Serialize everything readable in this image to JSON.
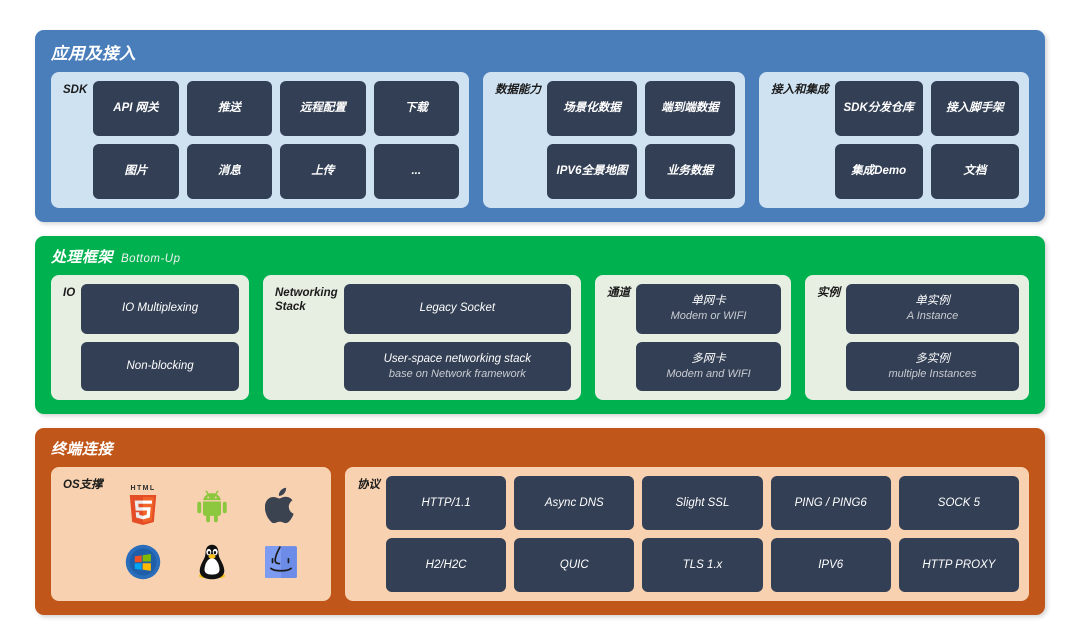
{
  "diagram": {
    "title_visible": false
  },
  "layers": [
    {
      "id": "application-access",
      "title": "应用及接入",
      "subtitle": "",
      "color": "#4a7ebb",
      "panel_color": "#cfe2f2",
      "panels": [
        {
          "id": "sdk",
          "label": "SDK",
          "columns": 4,
          "items": [
            {
              "text": "API 网关"
            },
            {
              "text": "推送"
            },
            {
              "text": "远程配置"
            },
            {
              "text": "下载"
            },
            {
              "text": "图片"
            },
            {
              "text": "消息"
            },
            {
              "text": "上传"
            },
            {
              "text": "..."
            }
          ]
        },
        {
          "id": "data-capability",
          "label": "数据能力",
          "columns": 2,
          "items": [
            {
              "text": "场景化数据"
            },
            {
              "text": "端到端数据"
            },
            {
              "text": "IPV6全景地图"
            },
            {
              "text": "业务数据"
            }
          ]
        },
        {
          "id": "access-integration",
          "label": "接入和集成",
          "columns": 2,
          "items": [
            {
              "text": "SDK分发仓库"
            },
            {
              "text": "接入脚手架"
            },
            {
              "text": "集成Demo"
            },
            {
              "text": "文档"
            }
          ]
        }
      ]
    },
    {
      "id": "processing-framework",
      "title": "处理框架",
      "subtitle": "Bottom-Up",
      "color": "#00b14f",
      "panel_color": "#e7efe3",
      "panels": [
        {
          "id": "io",
          "label": "IO",
          "columns": 1,
          "items": [
            {
              "text": "IO Multiplexing"
            },
            {
              "text": "Non-blocking"
            }
          ]
        },
        {
          "id": "networking-stack",
          "label": "Networking\nStack",
          "columns": 1,
          "items": [
            {
              "text": "Legacy Socket"
            },
            {
              "text": "User-space  networking stack",
              "sub": "base on Network framework"
            }
          ]
        },
        {
          "id": "channel",
          "label": "通道",
          "columns": 1,
          "items": [
            {
              "text": "单网卡",
              "sub": "Modem or WIFI"
            },
            {
              "text": "多网卡",
              "sub": "Modem and WIFI"
            }
          ]
        },
        {
          "id": "instance",
          "label": "实例",
          "columns": 1,
          "items": [
            {
              "text": "单实例",
              "sub": "A Instance"
            },
            {
              "text": "多实例",
              "sub": "multiple Instances"
            }
          ]
        }
      ]
    },
    {
      "id": "terminal-connection",
      "title": "终端连接",
      "subtitle": "",
      "color": "#c0561a",
      "panel_color": "#f8d2b0",
      "panels": [
        {
          "id": "os-support",
          "label": "OS支撑",
          "icons": [
            {
              "name": "html5-icon",
              "label": "HTML5",
              "word": "HTML",
              "digit": "5"
            },
            {
              "name": "android-icon",
              "label": "Android"
            },
            {
              "name": "apple-icon",
              "label": "Apple"
            },
            {
              "name": "windows-icon",
              "label": "Windows"
            },
            {
              "name": "linux-tux-icon",
              "label": "Linux"
            },
            {
              "name": "macos-finder-icon",
              "label": "macOS Finder"
            }
          ]
        },
        {
          "id": "protocols",
          "label": "协议",
          "columns": 5,
          "items": [
            {
              "text": "HTTP/1.1"
            },
            {
              "text": "Async DNS"
            },
            {
              "text": "Slight SSL"
            },
            {
              "text": "PING / PING6"
            },
            {
              "text": "SOCK 5"
            },
            {
              "text": "H2/H2C"
            },
            {
              "text": "QUIC"
            },
            {
              "text": "TLS 1.x"
            },
            {
              "text": "IPV6"
            },
            {
              "text": "HTTP PROXY"
            }
          ]
        }
      ]
    }
  ],
  "colors": {
    "chip": "#333f54",
    "blue_layer": "#4a7ebb",
    "green_layer": "#00b14f",
    "orange_layer": "#c0561a",
    "html5_orange": "#e44d26",
    "android_green": "#8dc63f",
    "windows_blue": "#2a6ebb",
    "finder_blue": "#6c8ce8"
  }
}
